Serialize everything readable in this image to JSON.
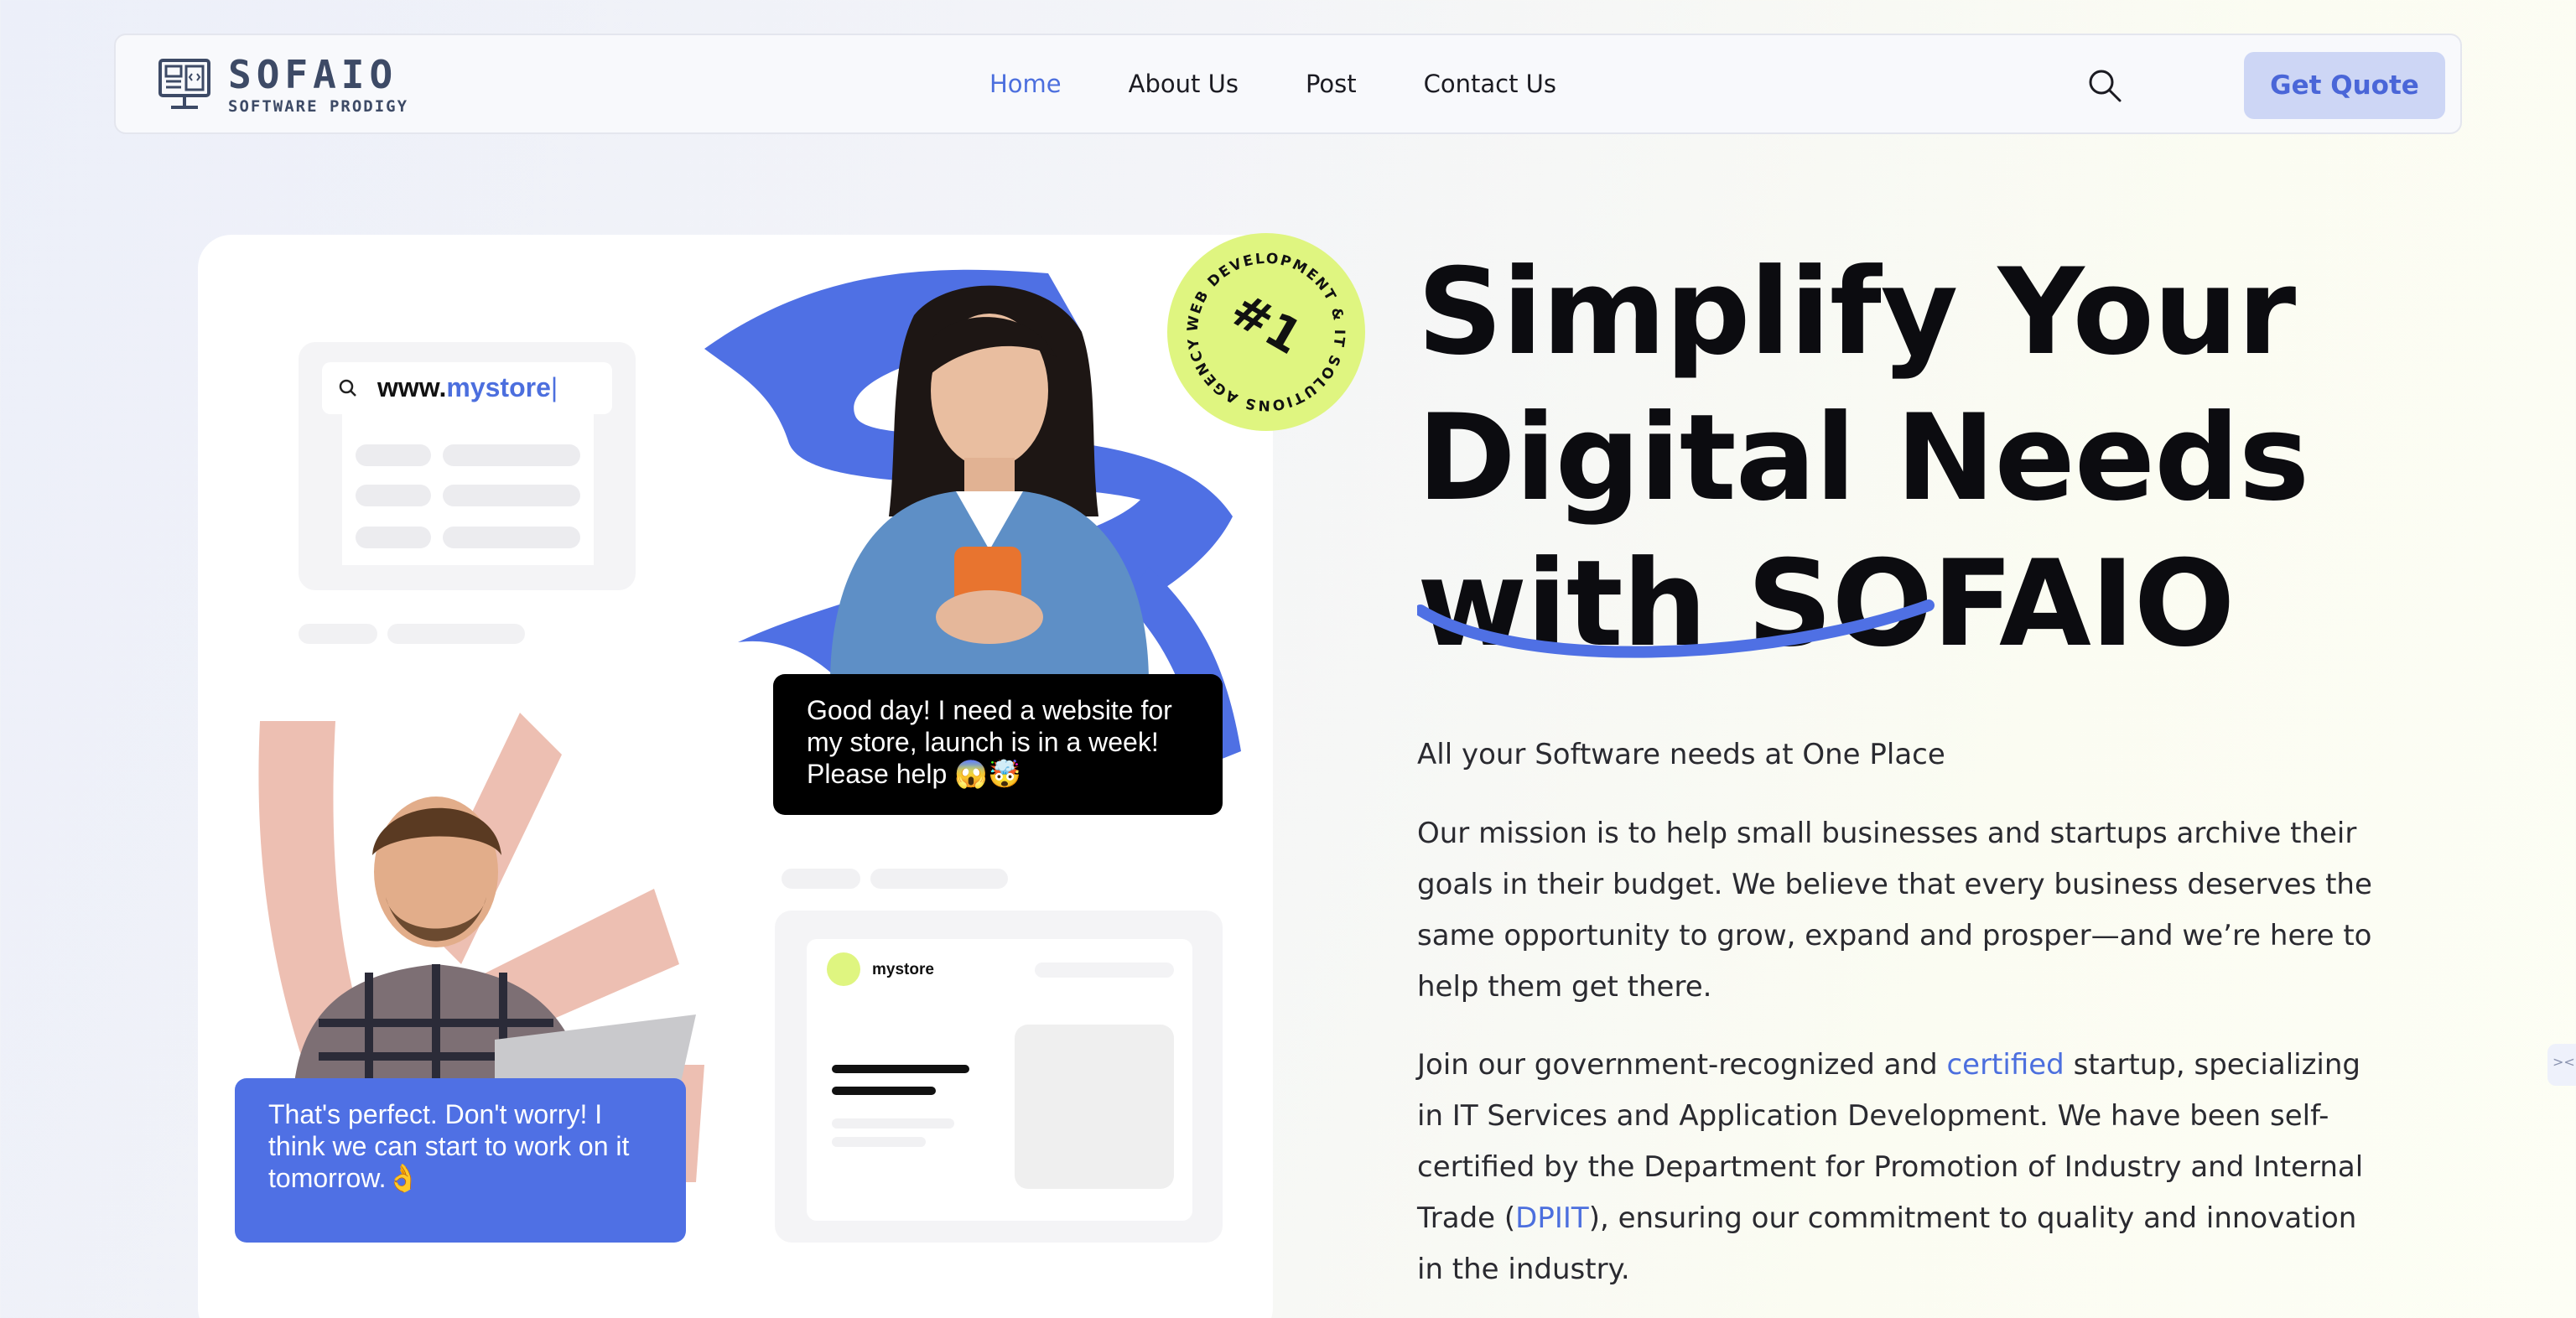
{
  "brand": {
    "name": "SOFAIO",
    "subtitle": "SOFTWARE PRODIGY",
    "logo_icon": "computer-monitor-icon"
  },
  "nav": {
    "items": [
      {
        "label": "Home",
        "active": true
      },
      {
        "label": "About Us",
        "active": false
      },
      {
        "label": "Post",
        "active": false
      },
      {
        "label": "Contact Us",
        "active": false
      }
    ],
    "search_icon": "search-icon",
    "cta_label": "Get Quote"
  },
  "illustration": {
    "url_prefix": "www.",
    "url_highlight": "mystore",
    "store_label": "mystore",
    "badge_text": "#1",
    "badge_ring": "WEB DEVELOPMENT & IT SOLUTIONS AGENCY",
    "client_message": "Good day! I need a website for my store, launch is in a week! Please help 😱🤯",
    "reply_message": "That's perfect. Don't worry! I think we can start to work on it tomorrow.👌"
  },
  "hero": {
    "headline_line1": "Simplify Your",
    "headline_line2": "Digital Needs",
    "headline_line3": "with SOFAIO",
    "tagline": "All your Software needs at One Place",
    "mission": "Our mission is to help small businesses and startups archive their goals in their budget. We believe that every business deserves the same opportunity to grow, expand and prosper—and we’re here to help them get there.",
    "join_part1": "Join our government-recognized and ",
    "join_link1": "certified",
    "join_part2": " startup, specializing in IT Services and Application Development. We have been self-certified by the Department for Promotion of Industry and Internal Trade (",
    "join_link2": "DPIIT",
    "join_part3": "), ensuring our commitment to quality and innovation in the industry."
  },
  "colors": {
    "accent": "#4c6fde",
    "badge": "#dff580",
    "cta_bg": "#cdd6f5",
    "salmon": "#edbfb2"
  },
  "edge_tab_text": "><"
}
